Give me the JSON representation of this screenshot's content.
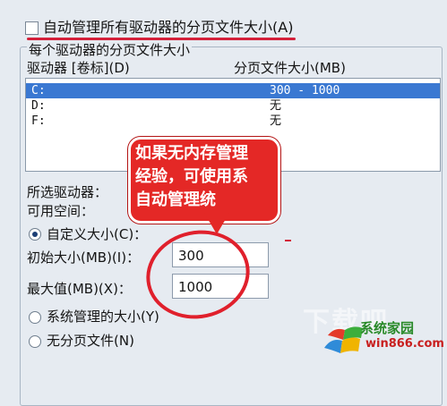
{
  "top_checkbox": {
    "label": "自动管理所有驱动器的分页文件大小(A)",
    "checked": false
  },
  "group": {
    "title": "每个驱动器的分页文件大小",
    "col_drive": "驱动器 [卷标](D)",
    "col_pagefile": "分页文件大小(MB)"
  },
  "drives": [
    {
      "drive": "C:",
      "pagefile": "300 - 1000",
      "selected": true
    },
    {
      "drive": "D:",
      "pagefile": "无",
      "selected": false
    },
    {
      "drive": "F:",
      "pagefile": "无",
      "selected": false
    }
  ],
  "bubble": {
    "line1": "如果无内存管理",
    "line2": "经验，可使用系",
    "line3": "自动管理统"
  },
  "selected_drive_label": "所选驱动器：",
  "space_available_label": "可用空间：",
  "options": {
    "custom_size": {
      "label": "自定义大小(C)：",
      "selected": true
    },
    "initial_size": {
      "label": "初始大小(MB)(I)：",
      "value": "300"
    },
    "max_size": {
      "label": "最大值(MB)(X)：",
      "value": "1000"
    },
    "system_managed": {
      "label": "系统管理的大小(Y)",
      "selected": false
    },
    "no_paging": {
      "label": "无分页文件(N)",
      "selected": false
    }
  },
  "watermark": {
    "big": "下载吧",
    "site_name": "系统家园",
    "url": "win866.com"
  },
  "colors": {
    "selection": "#3a78d2",
    "bubble": "#e42826",
    "annotation": "#e0202c"
  }
}
